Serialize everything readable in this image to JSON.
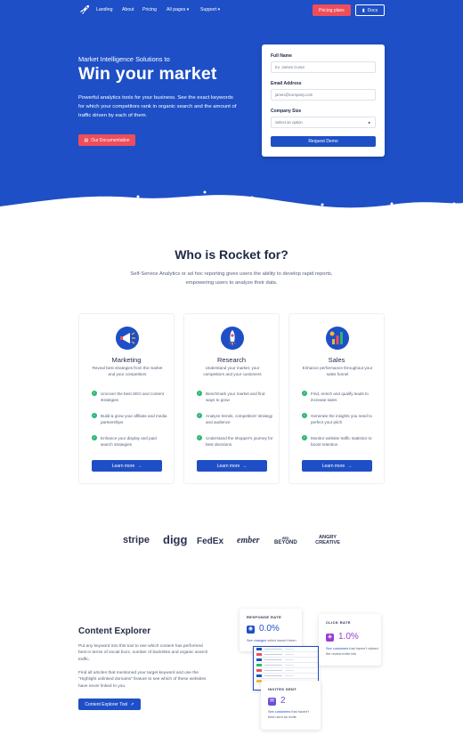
{
  "nav": {
    "links": [
      "Landing",
      "About",
      "Pricing",
      "All pages",
      "Support"
    ],
    "pricing_label": "Pricing plans",
    "docs_label": "Docs"
  },
  "hero": {
    "kicker": "Market Intelligence Solutions to",
    "title": "Win your market",
    "description": "Powerful analytics tools for your business. See the exact keywords for which your competitors rank in organic search and the amount of traffic driven by each of them.",
    "cta_label": "Our Documentation"
  },
  "form": {
    "name_label": "Full Name",
    "name_placeholder": "Ex. James Curan",
    "email_label": "Email Address",
    "email_placeholder": "james@company.com",
    "company_label": "Company Size",
    "company_value": "Select an option",
    "submit_label": "Request Demo"
  },
  "who": {
    "title": "Who is Rocket for?",
    "description": "Self-Service Analytics or ad hoc reporting gives users the ability to develop rapid reports, empowering users to analyze their data."
  },
  "cards": [
    {
      "title": "Marketing",
      "subtitle": "Reveal best strategies from the market and your competitors",
      "features": [
        "Uncover the best SEO and content strategies",
        "Build & grow your affiliate and media partnerships",
        "Enhance your display and paid search strategies"
      ],
      "cta": "Learn more"
    },
    {
      "title": "Research",
      "subtitle": "Understand your market, your competitors and your customers",
      "features": [
        "Benchmark your market and find ways to grow",
        "Analyze trends, competitors' strategy and audience",
        "Understand the shopper's journey for best decisions"
      ],
      "cta": "Learn more"
    },
    {
      "title": "Sales",
      "subtitle": "Enhance performance throughout your sales funnel",
      "features": [
        "Find, enrich and qualify leads to increase sales",
        "Generate the insights you need to perfect your pitch",
        "Monitor website traffic statistics to boost retention"
      ],
      "cta": "Learn more"
    }
  ],
  "brands": [
    "stripe",
    "digg",
    "FedEx",
    "ember",
    "BEYOND",
    "ANGRY CREATIVE"
  ],
  "brand_small": {
    "beyond_top": "BED",
    "fedex_suffix": "Ex"
  },
  "content_explorer": {
    "title": "Content Explorer",
    "p1": "Put any keyword into this tool to see which content has performed best in terms of social buzz, number of backlinks and organic search traffic.",
    "p2": "Find all articles that mentioned your target keyword and use the \"Highlight unlinked domains\" feature to see which of these websites have never linked to you.",
    "cta": "Content Explorer Tool"
  },
  "stats": {
    "response": {
      "label": "RESPONSE RATE",
      "value": "0.0%",
      "link": "See changes",
      "note": "which haven't been"
    },
    "click": {
      "label": "CLICK RATE",
      "value": "1.0%",
      "link": "See customers",
      "note": "that haven't clicked the review invite link"
    },
    "invites": {
      "label": "INVITES SENT",
      "value": "2",
      "link": "See customers",
      "note": "that haven't been sent an invite"
    }
  },
  "colors": {
    "primary": "#1e4fc6",
    "accent": "#ee4e5a",
    "check": "#2bb673",
    "purple": "#9b3bd1"
  },
  "icons": {
    "logo": "rocket-logo-icon",
    "docs": "book-icon",
    "doc_cta": "document-icon",
    "arrow": "arrow-right-icon",
    "external": "external-link-icon",
    "check": "check-icon"
  }
}
